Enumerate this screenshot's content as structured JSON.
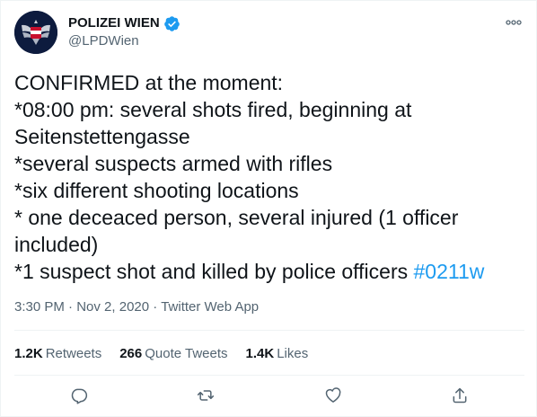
{
  "account": {
    "display_name": "POLIZEI WIEN",
    "handle": "@LPDWien",
    "verified": true,
    "avatar_icon": "police-eagle-crest-icon"
  },
  "tweet": {
    "text": "CONFIRMED at the moment:\n*08:00 pm: several shots fired, beginning at Seitenstettengasse\n*several suspects armed with rifles\n*six different shooting locations\n* one deceaced person, several injured (1 officer included)\n*1 suspect shot and killed by police officers ",
    "hashtag": "#0211w",
    "time": "3:30 PM",
    "separator": "·",
    "date": "Nov 2, 2020",
    "source": "Twitter Web App"
  },
  "stats": {
    "retweets_count": "1.2K",
    "retweets_label": "Retweets",
    "quotes_count": "266",
    "quotes_label": "Quote Tweets",
    "likes_count": "1.4K",
    "likes_label": "Likes"
  },
  "icons": {
    "more": "more-options-icon",
    "reply": "reply-icon",
    "retweet": "retweet-icon",
    "like": "like-icon",
    "share": "share-icon"
  },
  "colors": {
    "accent": "#1d9bf0",
    "text": "#0f1419",
    "secondary": "#536471",
    "avatar_bg": "#0d1b3e",
    "flag_red": "#c8102e"
  }
}
